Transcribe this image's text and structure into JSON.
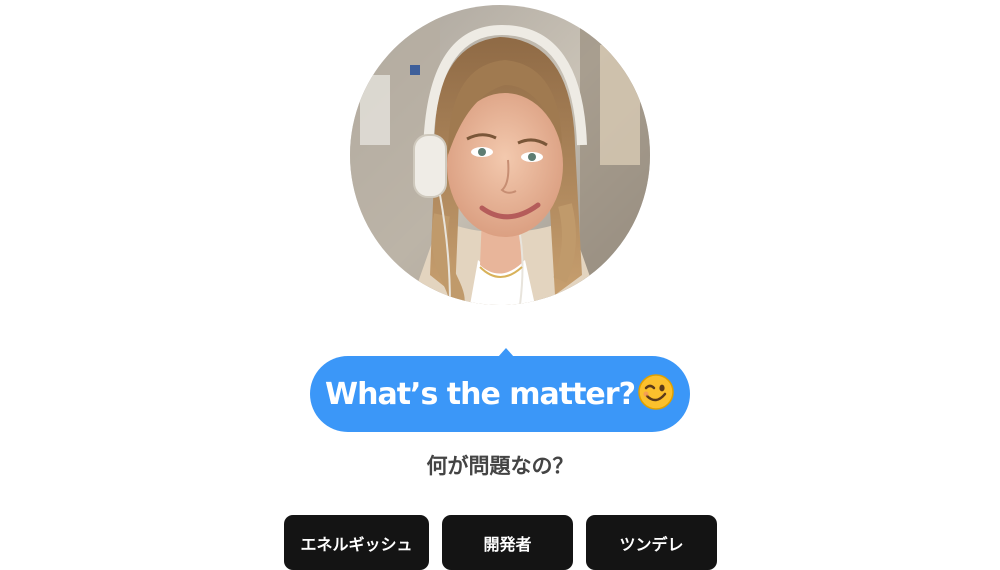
{
  "avatar": {
    "alt": "Smiling young woman with braided hair wearing white headphones on a city street",
    "icon": "profile-photo"
  },
  "bubble": {
    "text": "What’s the matter?",
    "emoji": "winking-face",
    "color": "#3b97f8"
  },
  "translation": "何が問題なの？",
  "chips": [
    {
      "label": "エネルギッシュ"
    },
    {
      "label": "開発者"
    },
    {
      "label": "ツンデレ"
    }
  ],
  "colors": {
    "chip_background": "#141414",
    "subtitle": "#444444"
  }
}
